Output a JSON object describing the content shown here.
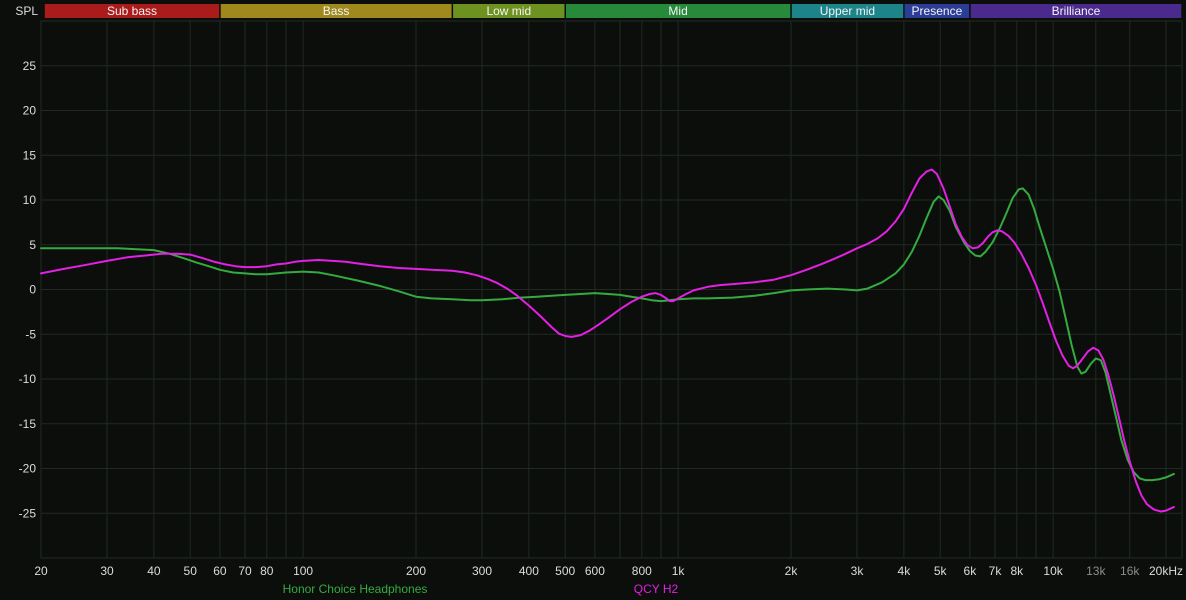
{
  "chart_data": {
    "type": "line",
    "title": "",
    "xlabel": "",
    "ylabel": "SPL",
    "x_scale": "log",
    "xlim": [
      20,
      21000
    ],
    "ylim": [
      -30,
      30
    ],
    "grid": true,
    "legend_position": "bottom",
    "background": "#0c0e0c",
    "grid_color": "#212921",
    "tick_color": "#dcdcdc",
    "muted_tick_color": "#8c8c8c",
    "band_label_color": "#f5f5f5",
    "y_ticks": [
      -25,
      -20,
      -15,
      -10,
      -5,
      0,
      5,
      10,
      15,
      20,
      25
    ],
    "x_ticks": [
      {
        "hz": 20,
        "label": "20"
      },
      {
        "hz": 30,
        "label": "30"
      },
      {
        "hz": 40,
        "label": "40"
      },
      {
        "hz": 50,
        "label": "50"
      },
      {
        "hz": 60,
        "label": "60"
      },
      {
        "hz": 70,
        "label": "70"
      },
      {
        "hz": 80,
        "label": "80"
      },
      {
        "hz": 100,
        "label": "100"
      },
      {
        "hz": 200,
        "label": "200"
      },
      {
        "hz": 300,
        "label": "300"
      },
      {
        "hz": 400,
        "label": "400"
      },
      {
        "hz": 500,
        "label": "500"
      },
      {
        "hz": 600,
        "label": "600"
      },
      {
        "hz": 800,
        "label": "800"
      },
      {
        "hz": 1000,
        "label": "1k"
      },
      {
        "hz": 2000,
        "label": "2k"
      },
      {
        "hz": 3000,
        "label": "3k"
      },
      {
        "hz": 4000,
        "label": "4k"
      },
      {
        "hz": 5000,
        "label": "5k"
      },
      {
        "hz": 6000,
        "label": "6k"
      },
      {
        "hz": 7000,
        "label": "7k"
      },
      {
        "hz": 8000,
        "label": "8k"
      },
      {
        "hz": 10000,
        "label": "10k"
      },
      {
        "hz": 13000,
        "label": "13k",
        "muted": true
      },
      {
        "hz": 16000,
        "label": "16k",
        "muted": true
      },
      {
        "hz": 20000,
        "label": "20kHz"
      }
    ],
    "x_grid_hz": [
      20,
      30,
      40,
      50,
      60,
      70,
      80,
      90,
      100,
      200,
      300,
      400,
      500,
      600,
      700,
      800,
      900,
      1000,
      2000,
      3000,
      4000,
      5000,
      6000,
      7000,
      8000,
      9000,
      10000,
      13000,
      16000,
      20000
    ],
    "frequency_bands": [
      {
        "label": "Sub bass",
        "from_hz": 20,
        "to_hz": 60,
        "color": "#aa1c1c"
      },
      {
        "label": "Bass",
        "from_hz": 60,
        "to_hz": 250,
        "color": "#9f881c"
      },
      {
        "label": "Low mid",
        "from_hz": 250,
        "to_hz": 500,
        "color": "#6e921f"
      },
      {
        "label": "Mid",
        "from_hz": 500,
        "to_hz": 2000,
        "color": "#268a3a"
      },
      {
        "label": "Upper mid",
        "from_hz": 2000,
        "to_hz": 4000,
        "color": "#1d8489"
      },
      {
        "label": "Presence",
        "from_hz": 4000,
        "to_hz": 6000,
        "color": "#2b3d96"
      },
      {
        "label": "Brilliance",
        "from_hz": 6000,
        "to_hz": 20000,
        "color": "#4b2a8d"
      }
    ],
    "series": [
      {
        "name": "Honor Choice Headphones",
        "color": "#35ab3f",
        "points": [
          [
            20,
            4.6
          ],
          [
            24,
            4.6
          ],
          [
            28,
            4.6
          ],
          [
            32,
            4.6
          ],
          [
            36,
            4.5
          ],
          [
            40,
            4.4
          ],
          [
            44,
            4.0
          ],
          [
            48,
            3.5
          ],
          [
            52,
            3.0
          ],
          [
            56,
            2.6
          ],
          [
            60,
            2.2
          ],
          [
            65,
            1.9
          ],
          [
            70,
            1.8
          ],
          [
            75,
            1.7
          ],
          [
            80,
            1.7
          ],
          [
            85,
            1.8
          ],
          [
            90,
            1.9
          ],
          [
            100,
            2.0
          ],
          [
            110,
            1.9
          ],
          [
            120,
            1.6
          ],
          [
            140,
            1.0
          ],
          [
            160,
            0.4
          ],
          [
            180,
            -0.2
          ],
          [
            200,
            -0.8
          ],
          [
            220,
            -1.0
          ],
          [
            250,
            -1.1
          ],
          [
            280,
            -1.2
          ],
          [
            300,
            -1.2
          ],
          [
            340,
            -1.1
          ],
          [
            380,
            -0.9
          ],
          [
            420,
            -0.8
          ],
          [
            460,
            -0.7
          ],
          [
            500,
            -0.6
          ],
          [
            550,
            -0.5
          ],
          [
            600,
            -0.4
          ],
          [
            650,
            -0.5
          ],
          [
            700,
            -0.6
          ],
          [
            750,
            -0.8
          ],
          [
            800,
            -1.0
          ],
          [
            850,
            -1.2
          ],
          [
            900,
            -1.3
          ],
          [
            950,
            -1.2
          ],
          [
            1000,
            -1.1
          ],
          [
            1100,
            -1.0
          ],
          [
            1200,
            -1.0
          ],
          [
            1400,
            -0.9
          ],
          [
            1600,
            -0.7
          ],
          [
            1800,
            -0.4
          ],
          [
            2000,
            -0.1
          ],
          [
            2200,
            0.0
          ],
          [
            2500,
            0.1
          ],
          [
            2800,
            0.0
          ],
          [
            3000,
            -0.1
          ],
          [
            3200,
            0.1
          ],
          [
            3500,
            0.8
          ],
          [
            3800,
            1.8
          ],
          [
            4000,
            2.8
          ],
          [
            4200,
            4.2
          ],
          [
            4400,
            6.0
          ],
          [
            4600,
            8.0
          ],
          [
            4800,
            9.8
          ],
          [
            4950,
            10.4
          ],
          [
            5100,
            10.0
          ],
          [
            5300,
            8.8
          ],
          [
            5500,
            7.0
          ],
          [
            5800,
            5.2
          ],
          [
            6000,
            4.3
          ],
          [
            6200,
            3.8
          ],
          [
            6400,
            3.7
          ],
          [
            6600,
            4.2
          ],
          [
            6900,
            5.3
          ],
          [
            7200,
            6.8
          ],
          [
            7500,
            8.5
          ],
          [
            7800,
            10.2
          ],
          [
            8100,
            11.2
          ],
          [
            8300,
            11.3
          ],
          [
            8600,
            10.6
          ],
          [
            8900,
            9.0
          ],
          [
            9200,
            7.0
          ],
          [
            9600,
            4.6
          ],
          [
            10000,
            2.3
          ],
          [
            10400,
            -0.2
          ],
          [
            10800,
            -3.2
          ],
          [
            11200,
            -6.2
          ],
          [
            11600,
            -8.6
          ],
          [
            11900,
            -9.4
          ],
          [
            12200,
            -9.2
          ],
          [
            12600,
            -8.3
          ],
          [
            13000,
            -7.7
          ],
          [
            13400,
            -7.9
          ],
          [
            13800,
            -9.3
          ],
          [
            14200,
            -11.5
          ],
          [
            14700,
            -14.2
          ],
          [
            15200,
            -16.8
          ],
          [
            15800,
            -19.0
          ],
          [
            16400,
            -20.4
          ],
          [
            17000,
            -21.1
          ],
          [
            17600,
            -21.3
          ],
          [
            18400,
            -21.3
          ],
          [
            19200,
            -21.2
          ],
          [
            20000,
            -21.0
          ],
          [
            21000,
            -20.6
          ]
        ]
      },
      {
        "name": "QCY H2",
        "color": "#e320e3",
        "points": [
          [
            20,
            1.8
          ],
          [
            23,
            2.3
          ],
          [
            26,
            2.7
          ],
          [
            30,
            3.2
          ],
          [
            34,
            3.6
          ],
          [
            38,
            3.8
          ],
          [
            42,
            4.0
          ],
          [
            46,
            4.0
          ],
          [
            50,
            3.9
          ],
          [
            54,
            3.5
          ],
          [
            58,
            3.1
          ],
          [
            62,
            2.8
          ],
          [
            66,
            2.6
          ],
          [
            70,
            2.5
          ],
          [
            75,
            2.5
          ],
          [
            80,
            2.6
          ],
          [
            85,
            2.8
          ],
          [
            90,
            2.9
          ],
          [
            95,
            3.1
          ],
          [
            100,
            3.2
          ],
          [
            110,
            3.3
          ],
          [
            120,
            3.2
          ],
          [
            130,
            3.1
          ],
          [
            140,
            2.9
          ],
          [
            160,
            2.6
          ],
          [
            180,
            2.4
          ],
          [
            200,
            2.3
          ],
          [
            220,
            2.2
          ],
          [
            250,
            2.1
          ],
          [
            270,
            1.9
          ],
          [
            290,
            1.6
          ],
          [
            310,
            1.2
          ],
          [
            330,
            0.7
          ],
          [
            350,
            0.1
          ],
          [
            370,
            -0.6
          ],
          [
            400,
            -1.8
          ],
          [
            430,
            -3.0
          ],
          [
            460,
            -4.2
          ],
          [
            480,
            -4.9
          ],
          [
            500,
            -5.2
          ],
          [
            520,
            -5.3
          ],
          [
            550,
            -5.1
          ],
          [
            580,
            -4.6
          ],
          [
            610,
            -4.0
          ],
          [
            650,
            -3.2
          ],
          [
            700,
            -2.2
          ],
          [
            750,
            -1.4
          ],
          [
            800,
            -0.8
          ],
          [
            840,
            -0.5
          ],
          [
            870,
            -0.4
          ],
          [
            900,
            -0.6
          ],
          [
            930,
            -1.0
          ],
          [
            950,
            -1.3
          ],
          [
            970,
            -1.3
          ],
          [
            1000,
            -1.0
          ],
          [
            1050,
            -0.5
          ],
          [
            1100,
            -0.1
          ],
          [
            1200,
            0.3
          ],
          [
            1300,
            0.5
          ],
          [
            1400,
            0.6
          ],
          [
            1600,
            0.8
          ],
          [
            1800,
            1.1
          ],
          [
            2000,
            1.6
          ],
          [
            2200,
            2.2
          ],
          [
            2400,
            2.8
          ],
          [
            2600,
            3.4
          ],
          [
            2800,
            4.0
          ],
          [
            3000,
            4.6
          ],
          [
            3200,
            5.1
          ],
          [
            3400,
            5.7
          ],
          [
            3600,
            6.5
          ],
          [
            3800,
            7.6
          ],
          [
            4000,
            9.0
          ],
          [
            4200,
            10.8
          ],
          [
            4400,
            12.4
          ],
          [
            4600,
            13.2
          ],
          [
            4750,
            13.4
          ],
          [
            4900,
            12.9
          ],
          [
            5100,
            11.3
          ],
          [
            5300,
            9.3
          ],
          [
            5500,
            7.3
          ],
          [
            5700,
            5.9
          ],
          [
            5900,
            5.0
          ],
          [
            6100,
            4.6
          ],
          [
            6300,
            4.7
          ],
          [
            6500,
            5.2
          ],
          [
            6700,
            5.9
          ],
          [
            6900,
            6.4
          ],
          [
            7100,
            6.6
          ],
          [
            7300,
            6.5
          ],
          [
            7600,
            6.0
          ],
          [
            7900,
            5.2
          ],
          [
            8200,
            4.1
          ],
          [
            8600,
            2.4
          ],
          [
            9000,
            0.5
          ],
          [
            9400,
            -1.6
          ],
          [
            9800,
            -3.8
          ],
          [
            10200,
            -5.8
          ],
          [
            10600,
            -7.4
          ],
          [
            11000,
            -8.5
          ],
          [
            11300,
            -8.8
          ],
          [
            11600,
            -8.5
          ],
          [
            12000,
            -7.7
          ],
          [
            12400,
            -6.9
          ],
          [
            12800,
            -6.5
          ],
          [
            13200,
            -6.8
          ],
          [
            13600,
            -7.8
          ],
          [
            14000,
            -9.4
          ],
          [
            14500,
            -11.8
          ],
          [
            15000,
            -14.4
          ],
          [
            15500,
            -17.0
          ],
          [
            16000,
            -19.2
          ],
          [
            16600,
            -21.4
          ],
          [
            17200,
            -23.0
          ],
          [
            17800,
            -24.0
          ],
          [
            18600,
            -24.6
          ],
          [
            19400,
            -24.8
          ],
          [
            20000,
            -24.7
          ],
          [
            21000,
            -24.3
          ]
        ]
      }
    ]
  }
}
